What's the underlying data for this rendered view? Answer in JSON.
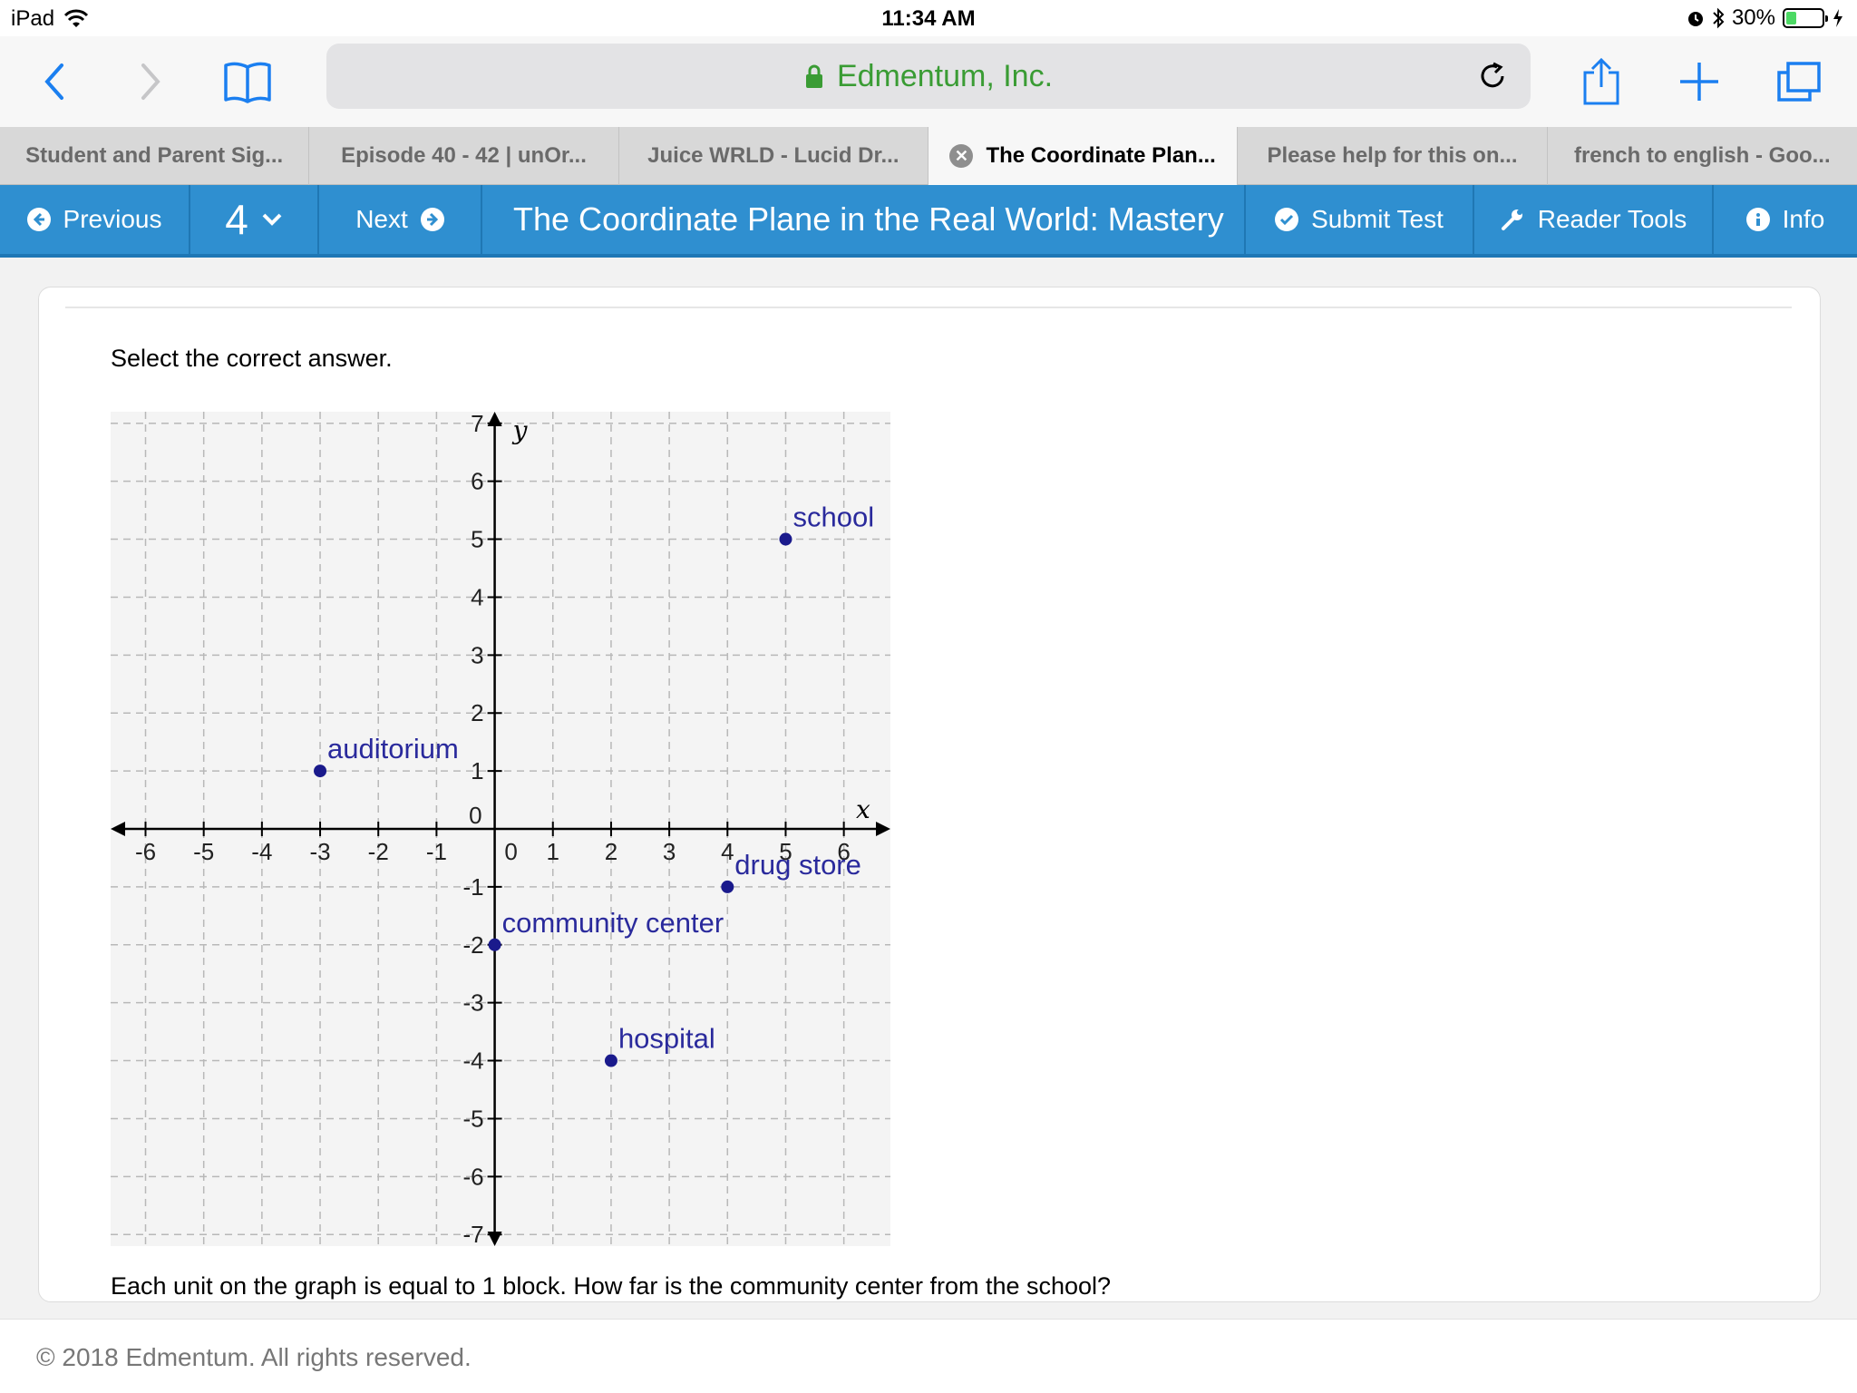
{
  "status_bar": {
    "device": "iPad",
    "time": "11:34 AM",
    "battery_percent": "30%",
    "battery_level": 0.3,
    "icons": [
      "wifi-icon",
      "alarm-icon",
      "bluetooth-icon",
      "battery-icon",
      "charging-icon"
    ]
  },
  "browser": {
    "address": "Edmentum, Inc.",
    "accent_color": "#3a9c34",
    "tab_close_label": "✕",
    "tabs": [
      {
        "label": "Student and Parent Sig..."
      },
      {
        "label": "Episode 40 - 42 | unOr..."
      },
      {
        "label": "Juice WRLD - Lucid Dr..."
      },
      {
        "label": "The Coordinate Plan...",
        "active": true
      },
      {
        "label": "Please help for this on..."
      },
      {
        "label": "french to english - Goo..."
      }
    ]
  },
  "app_nav": {
    "color": "#2f8fd0",
    "previous_label": "Previous",
    "question_number": "4",
    "next_label": "Next",
    "title": "The Coordinate Plane in the Real World: Mastery",
    "submit_label": "Submit Test",
    "reader_tools_label": "Reader Tools",
    "info_label": "Info"
  },
  "question": {
    "instruction": "Select the correct answer.",
    "text": "Each unit on the graph is equal to 1 block. How far is the community center from the school?"
  },
  "chart_data": {
    "type": "scatter",
    "xlabel": "x",
    "ylabel": "y",
    "xlim": [
      -6.6,
      6.8
    ],
    "ylim": [
      -7.2,
      7.2
    ],
    "grid": true,
    "x_ticks": [
      -6,
      -5,
      -4,
      -3,
      -2,
      -1,
      0,
      1,
      2,
      3,
      4,
      5,
      6
    ],
    "y_ticks": [
      -7,
      -6,
      -5,
      -4,
      -3,
      -2,
      -1,
      1,
      2,
      3,
      4,
      5,
      6,
      7
    ],
    "x_tick_labels": [
      "-6",
      "-5",
      "-4",
      "-3",
      "-2",
      "-1",
      "0",
      "1",
      "2",
      "3",
      "4",
      "5",
      "6"
    ],
    "y_tick_labels": [
      "-7",
      "-6",
      "-5",
      "-4",
      "-3",
      "-2",
      "-1",
      "1",
      "2",
      "3",
      "4",
      "5",
      "6",
      "7"
    ],
    "origin_label": "0",
    "point_color": "#1a1a8c",
    "points": [
      {
        "label": "school",
        "x": 5,
        "y": 5
      },
      {
        "label": "auditorium",
        "x": -3,
        "y": 1
      },
      {
        "label": "drug store",
        "x": 4,
        "y": -1
      },
      {
        "label": "community center",
        "x": 0,
        "y": -2
      },
      {
        "label": "hospital",
        "x": 2,
        "y": -4
      }
    ]
  },
  "footer": {
    "copyright": "© 2018 Edmentum. All rights reserved."
  }
}
